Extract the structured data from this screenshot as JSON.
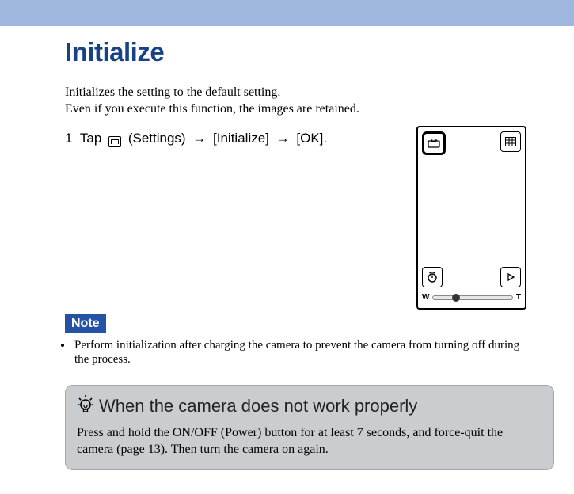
{
  "page": {
    "title": "Initialize",
    "intro_line1": "Initializes the setting to the default setting.",
    "intro_line2": "Even if you execute this function, the images are retained."
  },
  "step": {
    "num": "1",
    "tap": "Tap",
    "settings_label": "(Settings)",
    "arrow": "→",
    "item1": "[Initialize]",
    "item2": "[OK].",
    "icon_name": "settings-icon"
  },
  "camera_screen": {
    "top_left_icon": "toolbox-icon",
    "top_right_icon": "grid-icon",
    "bottom_left_icon": "self-timer-icon",
    "bottom_right_icon": "play-icon",
    "zoom": {
      "wide": "W",
      "tele": "T"
    }
  },
  "note": {
    "label": "Note",
    "bullets": [
      "Perform initialization after charging the camera to prevent the camera from turning off during the process."
    ]
  },
  "tip": {
    "title": "When the camera does not work properly",
    "body": "Press and hold the ON/OFF (Power) button for at least 7 seconds, and force-quit the camera (page 13). Then turn the camera on again."
  }
}
